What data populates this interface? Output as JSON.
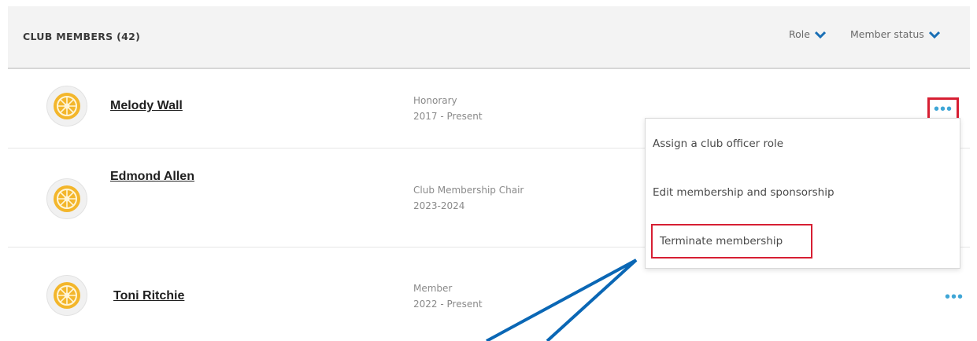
{
  "header": {
    "title": "CLUB MEMBERS (42)",
    "filters": [
      {
        "label": "Role"
      },
      {
        "label": "Member status"
      }
    ]
  },
  "members": [
    {
      "name": "Melody Wall",
      "role": "Honorary",
      "term": "2017 - Present",
      "avatar_icon": "rotary-wheel-icon"
    },
    {
      "name": "Edmond Allen",
      "role": "Club Membership Chair",
      "term": "2023-2024",
      "avatar_icon": "rotary-wheel-icon"
    },
    {
      "name": "Toni Ritchie",
      "role": "Member",
      "term": "2022 - Present",
      "avatar_icon": "rotary-wheel-icon"
    }
  ],
  "menu": {
    "items": [
      {
        "label": "Assign a club officer role"
      },
      {
        "label": "Edit membership and sponsorship"
      },
      {
        "label": "Terminate membership"
      }
    ]
  },
  "more_label": "•••",
  "colors": {
    "accent": "#3fa6d6",
    "highlight": "#d71f33",
    "arrow": "#0a67b5",
    "gold": "#f3b62b"
  }
}
